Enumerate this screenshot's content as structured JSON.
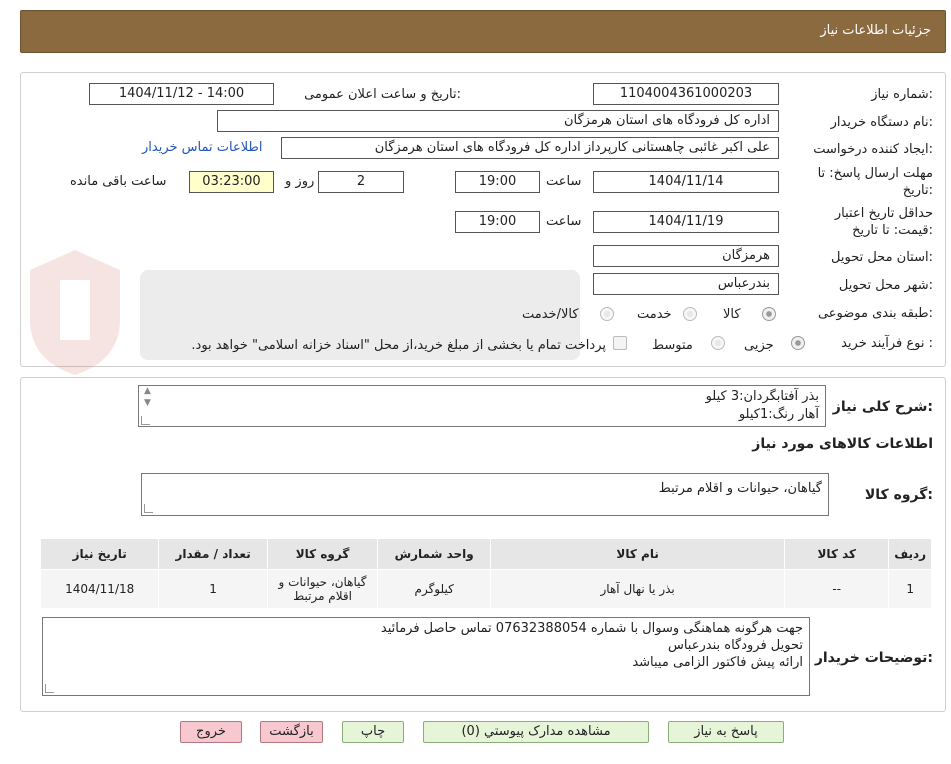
{
  "header": {
    "title": "جزئیات اطلاعات نیاز"
  },
  "form": {
    "need_number_label": "شماره نیاز:",
    "need_number": "1104004361000203",
    "announce_label": "تاریخ و ساعت اعلان عمومی:",
    "announce_value": "1404/11/12 - 14:00",
    "buyer_org_label": "نام دستگاه خریدار:",
    "buyer_org": "اداره کل فرودگاه های استان هرمزگان",
    "requester_label": "ایجاد کننده درخواست:",
    "requester": "علی اکبر غائبی چاهستانی کارپرداز اداره کل فرودگاه های استان هرمزگان",
    "contact_link": "اطلاعات تماس خریدار",
    "deadline_label_1": "مهلت ارسال پاسخ: تا",
    "deadline_label_2": "تاریخ:",
    "deadline_date": "1404/11/14",
    "time_label": "ساعت",
    "deadline_time": "19:00",
    "days_value": "2",
    "days_label": "روز و",
    "remaining_time": "03:23:00",
    "remaining_label": "ساعت باقی مانده",
    "validity_label_1": "حداقل تاریخ اعتبار",
    "validity_label_2": "قیمت: تا تاریخ:",
    "validity_date": "1404/11/19",
    "validity_time_label": "ساعت",
    "validity_time": "19:00",
    "province_label": "استان محل تحویل:",
    "province": "هرمزگان",
    "city_label": "شهر محل تحویل:",
    "city": "بندرعباس",
    "category_label": "طبقه بندی موضوعی:",
    "category_options": [
      "کالا",
      "خدمت",
      "کالا/خدمت"
    ],
    "process_label": "نوع فرآیند خرید :",
    "process_options": [
      "جزیی",
      "متوسط"
    ],
    "payment_note": "پرداخت تمام یا بخشی از مبلغ خرید،از محل \"اسناد خزانه اسلامی\" خواهد بود."
  },
  "summary": {
    "label": "شرح کلی نیاز:",
    "lines": [
      "بذر آفتابگردان:3 کیلو",
      "آهار رنگ:1کیلو"
    ],
    "goods_info_title": "اطلاعات کالاهای مورد نیاز",
    "goods_group_label": "گروه کالا:",
    "goods_group_value": "گیاهان، حیوانات و اقلام مرتبط"
  },
  "table": {
    "headers": [
      "ردیف",
      "کد کالا",
      "نام کالا",
      "واحد شمارش",
      "گروه کالا",
      "تعداد / مقدار",
      "تاریخ نیاز"
    ],
    "rows": [
      [
        "1",
        "--",
        "بذر یا نهال آهار",
        "کیلوگرم",
        "گیاهان، حیوانات و اقلام مرتبط",
        "1",
        "1404/11/18"
      ]
    ]
  },
  "buyer_notes": {
    "label": "توضیحات خریدار:",
    "lines": [
      "جهت هرگونه هماهنگی وسوال با شماره 07632388054 تماس حاصل فرمائید",
      "تحویل فرودگاه بندرعباس",
      "ارائه پیش فاکتور الزامی میباشد"
    ]
  },
  "buttons": {
    "reply": "پاسخ به نیاز",
    "attachments": "مشاهده مدارک پیوستي (0)",
    "print": "چاپ",
    "back": "بازگشت",
    "exit": "خروج"
  },
  "colors": {
    "header_bg": "#8c6a3f",
    "green_button": "#e6f5d8",
    "pink_button": "#f7c8cf",
    "highlight_box": "#ffffcc",
    "link": "#2255bb"
  }
}
